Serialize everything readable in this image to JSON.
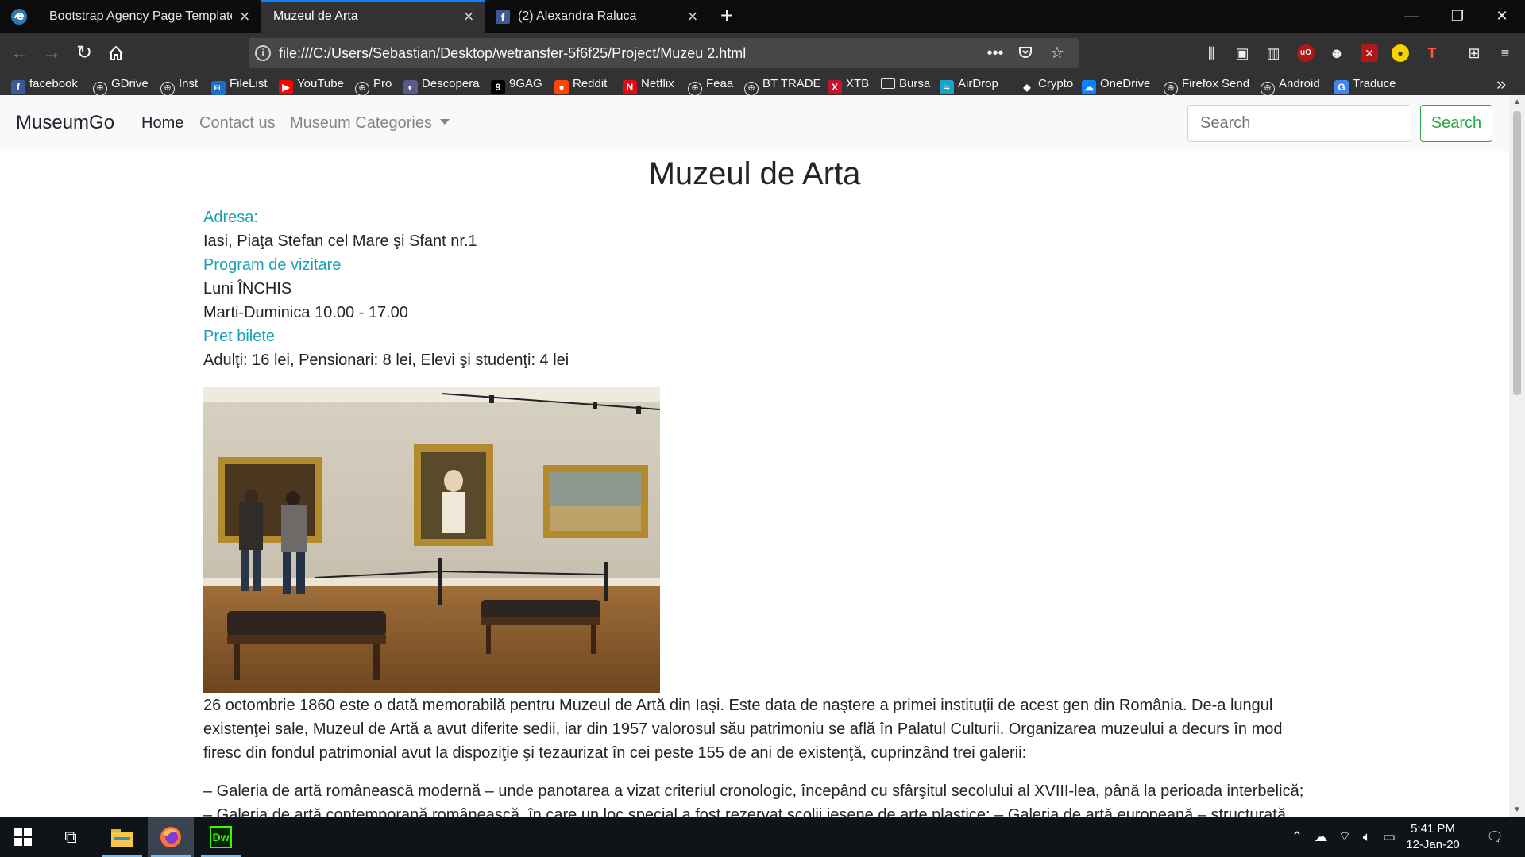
{
  "browser": {
    "tabs": [
      {
        "title": "Bootstrap Agency Page Template",
        "active": false
      },
      {
        "title": "Muzeul de Arta",
        "active": true
      },
      {
        "title": "(2) Alexandra Raluca",
        "active": false
      }
    ],
    "new_tab_icon": "plus-icon",
    "window_controls": [
      "minimize-icon",
      "restore-icon",
      "close-icon"
    ],
    "url": "file:///C:/Users/Sebastian/Desktop/wetransfer-5f6f25/Project/Muzeu 2.html",
    "bookmarks": [
      {
        "label": "facebook",
        "icon": "facebook-icon",
        "color": "#3b5998"
      },
      {
        "label": "GDrive",
        "icon": "globe-icon"
      },
      {
        "label": "Inst",
        "icon": "globe-icon"
      },
      {
        "label": "FileList",
        "icon": "filelist-icon",
        "color": "#1f6fc5"
      },
      {
        "label": "YouTube",
        "icon": "youtube-icon",
        "color": "#ff0000"
      },
      {
        "label": "Pro",
        "icon": "globe-icon"
      },
      {
        "label": "Descopera",
        "icon": "descopera-icon",
        "color": "#5a5a8a"
      },
      {
        "label": "9GAG",
        "icon": "9gag-icon",
        "color": "#000000"
      },
      {
        "label": "Reddit",
        "icon": "reddit-icon",
        "color": "#ff4500"
      },
      {
        "label": "Netflix",
        "icon": "netflix-icon",
        "color": "#e50914"
      },
      {
        "label": "Feaa",
        "icon": "globe-icon"
      },
      {
        "label": "BT TRADE",
        "icon": "globe-icon"
      },
      {
        "label": "XTB",
        "icon": "xtb-icon",
        "color": "#c4122f"
      },
      {
        "label": "Bursa",
        "icon": "folder-icon"
      },
      {
        "label": "AirDrop",
        "icon": "airdrop-icon",
        "color": "#1aa3c8"
      },
      {
        "label": "Crypto",
        "icon": "crypto-icon",
        "color": "#323234"
      },
      {
        "label": "OneDrive",
        "icon": "onedrive-icon",
        "color": "#0a84ff"
      },
      {
        "label": "Firefox Send",
        "icon": "globe-icon"
      },
      {
        "label": "Android",
        "icon": "globe-icon"
      },
      {
        "label": "Traduce",
        "icon": "translate-icon",
        "color": "#4285f4"
      }
    ]
  },
  "site": {
    "brand": "MuseumGo",
    "nav": {
      "home": "Home",
      "contact": "Contact us",
      "categories": "Museum Categories"
    },
    "search": {
      "placeholder": "Search",
      "button": "Search"
    },
    "accent_label_color": "#17a2b8",
    "search_button_color": "#28a745"
  },
  "museum": {
    "title": "Muzeul de Arta",
    "address_label": "Adresa:",
    "address": "Iasi, Piaţa Stefan cel Mare şi Sfant nr.1",
    "schedule_label": "Program de vizitare",
    "schedule_monday": "Luni ÎNCHIS",
    "schedule_week": "Marti-Duminica 10.00 - 17.00",
    "price_label": "Pret bilete",
    "prices": "Adulţi: 16 lei, Pensionari: 8 lei, Elevi şi studenţi: 4 lei",
    "paragraph1": "26 octombrie 1860 este o dată memorabilă pentru Muzeul de Artă din Iaşi. Este data de naştere a primei instituţii de acest gen din România. De-a lungul existenţei sale, Muzeul de Artă a avut diferite sedii, iar din 1957 valorosul său patrimoniu se află în Palatul Culturii. Organizarea muzeului a decurs în mod firesc din fondul patrimonial avut la dispoziţie şi tezaurizat în cei peste 155 de ani de existenţă, cuprinzând trei galerii:",
    "paragraph2": "– Galeria de artă românească modernă – unde panotarea a vizat criteriul cronologic, începând cu sfârşitul secolului al XVIII-lea, până la perioada interbelică; – Galeria de artă contemporană românească, în care un loc special a fost rezervat şcolii ieşene de arte plastice; – Galeria de artă europeană – structurată pe"
  },
  "taskbar": {
    "time": "5:41 PM",
    "date": "12-Jan-20",
    "apps": [
      "start-icon",
      "task-view-icon",
      "file-explorer-icon",
      "firefox-icon",
      "dreamweaver-icon"
    ]
  }
}
